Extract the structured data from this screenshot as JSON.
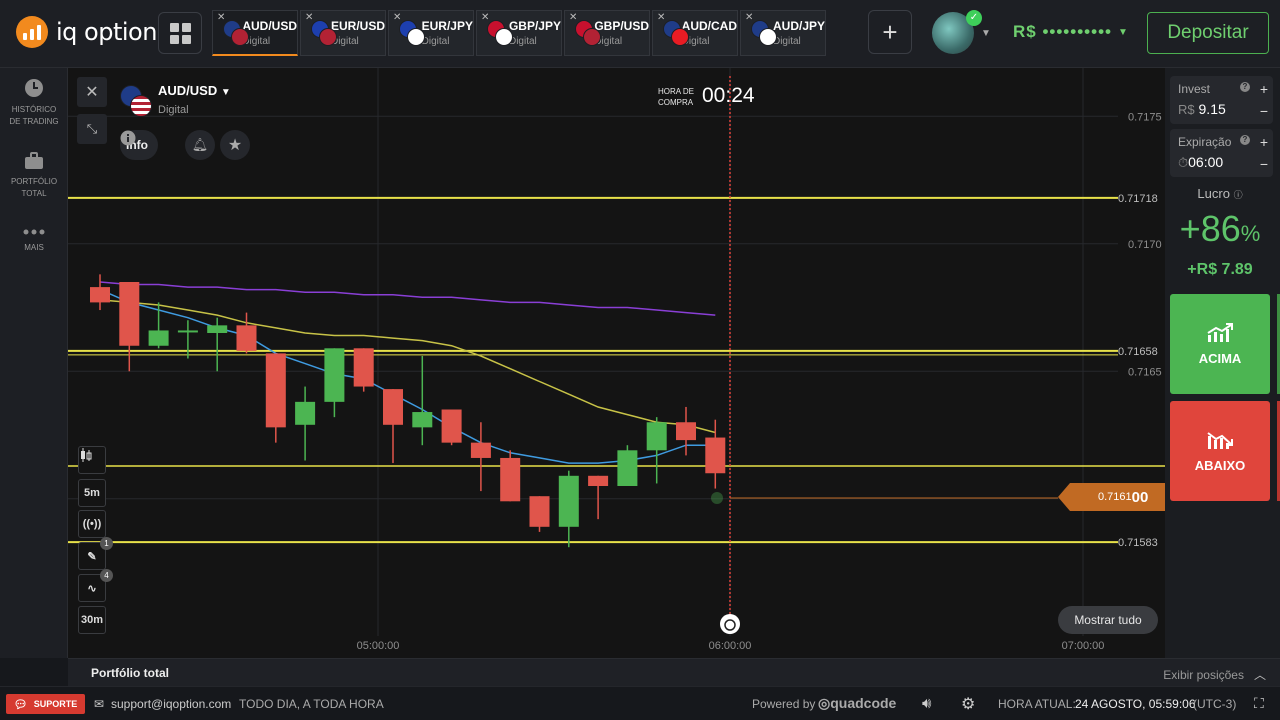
{
  "app": {
    "logo_text": "iq option"
  },
  "tabs": [
    {
      "symbol": "AUD/USD",
      "type": "Digital",
      "active": true,
      "flag_a": "#1f3c88",
      "flag_b": "#b22234"
    },
    {
      "symbol": "EUR/USD",
      "type": "Digital",
      "active": false,
      "flag_a": "#1d3fae",
      "flag_b": "#b22234"
    },
    {
      "symbol": "EUR/JPY",
      "type": "Digital",
      "active": false,
      "flag_a": "#1d3fae",
      "flag_b": "#ffffff"
    },
    {
      "symbol": "GBP/JPY",
      "type": "Digital",
      "active": false,
      "flag_a": "#c8102e",
      "flag_b": "#ffffff"
    },
    {
      "symbol": "GBP/USD",
      "type": "Digital",
      "active": false,
      "flag_a": "#c8102e",
      "flag_b": "#b22234"
    },
    {
      "symbol": "AUD/CAD",
      "type": "Digital",
      "active": false,
      "flag_a": "#1f3c88",
      "flag_b": "#e81c24"
    },
    {
      "symbol": "AUD/JPY",
      "type": "Digital",
      "active": false,
      "flag_a": "#1f3c88",
      "flag_b": "#ffffff"
    }
  ],
  "header": {
    "balance": "R$ ••••••••••",
    "deposit_label": "Depositar"
  },
  "sidebar": [
    {
      "label1": "HISTÓRICO",
      "label2": "DE TRADING",
      "icon": "clock-icon"
    },
    {
      "label1": "PORTFÓLIO",
      "label2": "TOTAL",
      "icon": "briefcase-icon"
    },
    {
      "label1": "MAIS",
      "label2": "",
      "icon": "more-icon"
    }
  ],
  "asset": {
    "symbol": "AUD/USD",
    "type": "Digital",
    "info_label": "Info"
  },
  "timer": {
    "label_line1": "HORA DE",
    "label_line2": "COMPRA",
    "value": "00:24"
  },
  "tools": {
    "timeframe": "5m",
    "draw_badge": "1",
    "indicator_badge": "4",
    "interval": "30m"
  },
  "show_all_label": "Mostrar tudo",
  "current_price": {
    "prefix": "0.7161",
    "suffix": "00"
  },
  "chart_data": {
    "type": "candlestick",
    "x_ticks": [
      "05:00:00",
      "06:00:00",
      "07:00:00"
    ],
    "y_ticks": [
      "0.7175",
      "0.7170",
      "0.7165",
      "0.7160"
    ],
    "levels": [
      "0.71718",
      "0.71658",
      "0.71583"
    ],
    "ylim": [
      0.71565,
      0.71765
    ],
    "candles": [
      {
        "o": 0.71683,
        "c": 0.71677,
        "h": 0.71688,
        "l": 0.71674
      },
      {
        "o": 0.71685,
        "c": 0.7166,
        "h": 0.71685,
        "l": 0.7165
      },
      {
        "o": 0.7166,
        "c": 0.71666,
        "h": 0.71677,
        "l": 0.71659
      },
      {
        "o": 0.71666,
        "c": 0.71666,
        "h": 0.7167,
        "l": 0.71655
      },
      {
        "o": 0.71665,
        "c": 0.71668,
        "h": 0.71671,
        "l": 0.7165
      },
      {
        "o": 0.71668,
        "c": 0.71658,
        "h": 0.71673,
        "l": 0.71657
      },
      {
        "o": 0.71657,
        "c": 0.71628,
        "h": 0.71657,
        "l": 0.71622
      },
      {
        "o": 0.71629,
        "c": 0.71638,
        "h": 0.71644,
        "l": 0.71615
      },
      {
        "o": 0.71638,
        "c": 0.71659,
        "h": 0.71659,
        "l": 0.71632
      },
      {
        "o": 0.71659,
        "c": 0.71644,
        "h": 0.71659,
        "l": 0.71642
      },
      {
        "o": 0.71643,
        "c": 0.71629,
        "h": 0.71643,
        "l": 0.71614
      },
      {
        "o": 0.71628,
        "c": 0.71634,
        "h": 0.71656,
        "l": 0.71621
      },
      {
        "o": 0.71635,
        "c": 0.71622,
        "h": 0.71635,
        "l": 0.71621
      },
      {
        "o": 0.71622,
        "c": 0.71616,
        "h": 0.7163,
        "l": 0.71603
      },
      {
        "o": 0.71616,
        "c": 0.71599,
        "h": 0.71619,
        "l": 0.71599
      },
      {
        "o": 0.71601,
        "c": 0.71589,
        "h": 0.71601,
        "l": 0.71587
      },
      {
        "o": 0.71589,
        "c": 0.71609,
        "h": 0.71611,
        "l": 0.71581
      },
      {
        "o": 0.71609,
        "c": 0.71605,
        "h": 0.71609,
        "l": 0.71592
      },
      {
        "o": 0.71605,
        "c": 0.71619,
        "h": 0.71621,
        "l": 0.71605
      },
      {
        "o": 0.71619,
        "c": 0.7163,
        "h": 0.71632,
        "l": 0.71606
      },
      {
        "o": 0.7163,
        "c": 0.71623,
        "h": 0.71636,
        "l": 0.71617
      },
      {
        "o": 0.71624,
        "c": 0.7161,
        "h": 0.71631,
        "l": 0.71604
      }
    ],
    "ma_fast": [
      0.71682,
      0.71677,
      0.71674,
      0.71671,
      0.71667,
      0.71664,
      0.71657,
      0.71653,
      0.71649,
      0.71647,
      0.71641,
      0.71635,
      0.71628,
      0.71622,
      0.71618,
      0.71616,
      0.71614,
      0.71614,
      0.71615,
      0.71617,
      0.71621,
      0.71621
    ],
    "ma_slow": [
      0.71678,
      0.71677,
      0.71676,
      0.71674,
      0.71672,
      0.71669,
      0.71667,
      0.71665,
      0.71664,
      0.71664,
      0.71663,
      0.71662,
      0.7166,
      0.71656,
      0.71651,
      0.71646,
      0.71641,
      0.71636,
      0.71633,
      0.7163,
      0.71629,
      0.71626
    ],
    "ma_long": [
      0.71685,
      0.71684,
      0.71684,
      0.71683,
      0.71683,
      0.71682,
      0.71682,
      0.71681,
      0.71681,
      0.7168,
      0.7168,
      0.71679,
      0.71679,
      0.71678,
      0.71677,
      0.71677,
      0.71676,
      0.71675,
      0.71675,
      0.71674,
      0.71673,
      0.71672
    ],
    "colors": {
      "up": "#4cb552",
      "down": "#e0554b",
      "level": "#e8e24a",
      "ma_fast": "#3f9be0",
      "ma_slow": "#c7c247",
      "ma_long": "#8a3fd6",
      "timeline": "#e0453c"
    }
  },
  "panel": {
    "invest_label": "Invest",
    "invest_currency": "R$",
    "invest_value": "9.15",
    "expiry_label": "Expiração",
    "expiry_value": "06:00",
    "profit_label": "Lucro",
    "profit_pct": "+86",
    "profit_pct_sign": "%",
    "profit_value": "+R$ 7.89",
    "up_label": "ACIMA",
    "down_label": "ABAIXO"
  },
  "portfolio_bar": {
    "title": "Portfólio total",
    "right_label": "Exibir posições"
  },
  "status": {
    "support_label": "SUPORTE",
    "email": "support@iqoption.com",
    "hours": "TODO DIA, A TODA HORA",
    "powered_label": "Powered by",
    "powered_brand": "quadcode",
    "time_label": "HORA ATUAL:",
    "time_value": "24 AGOSTO, 05:59:06",
    "tz": "(UTC-3)"
  }
}
